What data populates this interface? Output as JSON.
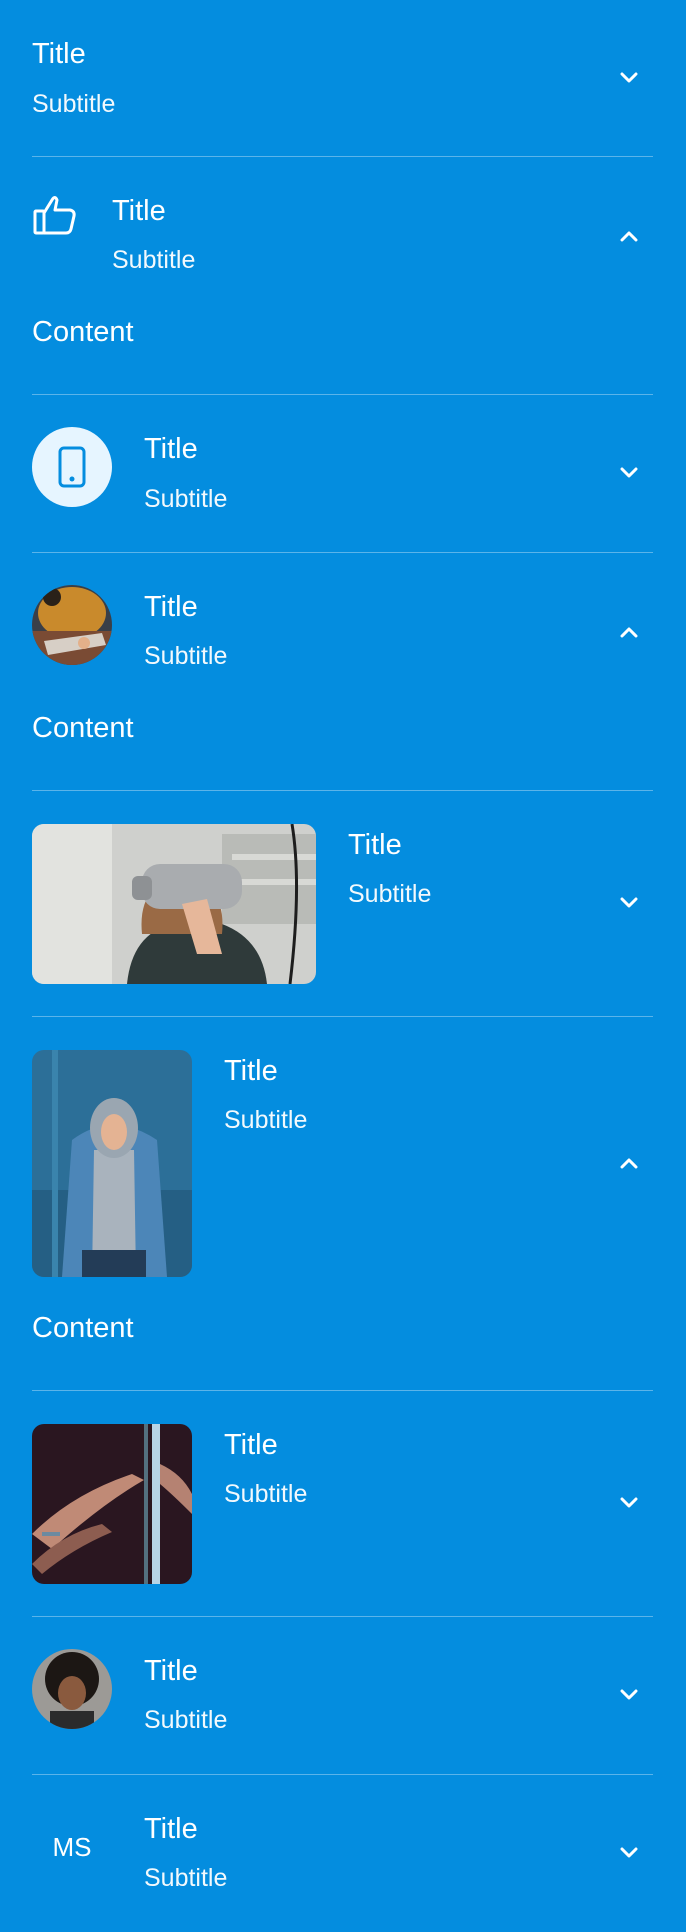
{
  "items": [
    {
      "title": "Title",
      "subtitle": "Subtitle",
      "expanded": false,
      "leading": "none"
    },
    {
      "title": "Title",
      "subtitle": "Subtitle",
      "expanded": true,
      "content": "Content",
      "leading": "thumb-up-icon"
    },
    {
      "title": "Title",
      "subtitle": "Subtitle",
      "expanded": false,
      "leading": "phone-icon"
    },
    {
      "title": "Title",
      "subtitle": "Subtitle",
      "expanded": true,
      "content": "Content",
      "leading": "avatar-image"
    },
    {
      "title": "Title",
      "subtitle": "Subtitle",
      "expanded": false,
      "leading": "wide-image"
    },
    {
      "title": "Title",
      "subtitle": "Subtitle",
      "expanded": true,
      "content": "Content",
      "leading": "tall-image"
    },
    {
      "title": "Title",
      "subtitle": "Subtitle",
      "expanded": false,
      "leading": "square-image"
    },
    {
      "title": "Title",
      "subtitle": "Subtitle",
      "expanded": false,
      "leading": "avatar-image"
    },
    {
      "title": "Title",
      "subtitle": "Subtitle",
      "expanded": false,
      "leading": "initials",
      "initials": "MS"
    }
  ],
  "colors": {
    "background": "#048ddf",
    "text": "#ffffff",
    "icon_circle": "#e6f5ff",
    "icon_stroke": "#048ddf"
  }
}
